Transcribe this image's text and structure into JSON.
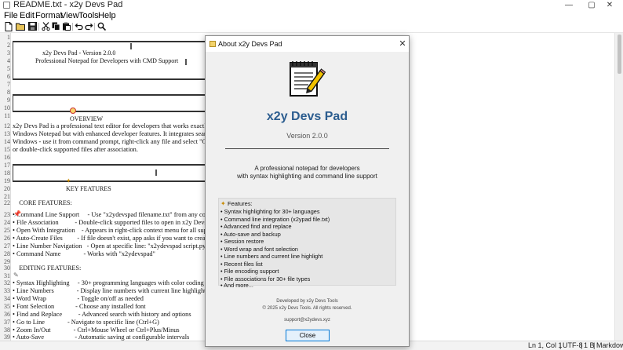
{
  "window": {
    "title": "README.txt - x2y Devs Pad",
    "minimize_glyph": "—",
    "maximize_glyph": "▢",
    "close_glyph": "✕"
  },
  "menu": [
    "File",
    "Edit",
    "Format",
    "View",
    "Tools",
    "Help"
  ],
  "toolbar": {
    "buttons": [
      "new-file-icon",
      "open-file-icon",
      "save-icon",
      "cut-icon",
      "copy-icon",
      "paste-icon",
      "undo-icon",
      "redo-icon",
      "find-icon"
    ]
  },
  "editor": {
    "header_line1": "x2y Devs Pad - Version 2.0.0",
    "header_line2": "Professional Notepad for Developers with CMD Support",
    "overview_heading": "OVERVIEW",
    "key_features_heading": "KEY FEATURES",
    "lines": [
      {
        "n": "1",
        "t": ""
      },
      {
        "n": "2",
        "t": ""
      },
      {
        "n": "3",
        "t": ""
      },
      {
        "n": "4",
        "t": ""
      },
      {
        "n": "5",
        "t": ""
      },
      {
        "n": "6",
        "t": ""
      },
      {
        "n": "7",
        "t": ""
      },
      {
        "n": "8",
        "t": ""
      },
      {
        "n": "9",
        "t": ""
      },
      {
        "n": "10",
        "t": ""
      },
      {
        "n": "11",
        "t": ""
      },
      {
        "n": "12",
        "t": "x2y Devs Pad is a professional text editor for developers that works exactly like"
      },
      {
        "n": "13",
        "t": "Windows Notepad but with enhanced developer features. It integrates seamlessly with"
      },
      {
        "n": "14",
        "t": "Windows - use it from command prompt, right-click any file and select \"Open with\","
      },
      {
        "n": "15",
        "t": "or double-click supported files after association."
      },
      {
        "n": "16",
        "t": ""
      },
      {
        "n": "17",
        "t": ""
      },
      {
        "n": "18",
        "t": ""
      },
      {
        "n": "19",
        "t": ""
      },
      {
        "n": "20",
        "t": ""
      },
      {
        "n": "21",
        "t": ""
      },
      {
        "n": "22",
        "t": "    CORE FEATURES:"
      },
      {
        "n": "23",
        "t": "• Command Line Support     - Use \"x2ydevspad filename.txt\" from any command prompt"
      },
      {
        "n": "24",
        "t": "• File Association          - Double-click supported files to open in x2y Devs Pad"
      },
      {
        "n": "25",
        "t": "• Open With Integration    - Appears in right-click context menu for all supported files"
      },
      {
        "n": "26",
        "t": "• Auto-Create Files         - If file doesn't exist, app asks if you want to create it"
      },
      {
        "n": "27",
        "t": "• Line Number Navigation   - Open at specific line: \"x2ydevspad script.py:42\""
      },
      {
        "n": "28",
        "t": "• Command Name              - Works with \"x2ydevspad\""
      },
      {
        "n": "29",
        "t": ""
      },
      {
        "n": "30",
        "t": "    EDITING FEATURES:"
      },
      {
        "n": "31",
        "t": ""
      },
      {
        "n": "32",
        "t": "• Syntax Highlighting     - 30+ programming languages with color coding"
      },
      {
        "n": "33",
        "t": "• Line Numbers              - Display line numbers with current line highlight"
      },
      {
        "n": "34",
        "t": "• Word Wrap                   - Toggle on/off as needed"
      },
      {
        "n": "35",
        "t": "• Font Selection             - Choose any installed font"
      },
      {
        "n": "36",
        "t": "• Find and Replace          - Advanced search with history and options"
      },
      {
        "n": "37",
        "t": "• Go to Line              - Navigate to specific line (Ctrl+G)"
      },
      {
        "n": "38",
        "t": "• Zoom In/Out              - Ctrl+Mouse Wheel or Ctrl+Plus/Minus"
      },
      {
        "n": "39",
        "t": "• Auto-Save                   - Automatic saving at configurable intervals"
      }
    ]
  },
  "status": {
    "position": "Ln 1, Col 1",
    "encoding": "UTF-8",
    "size": "1 B",
    "language": "Markdown"
  },
  "about": {
    "title": "About x2y Devs Pad",
    "close_glyph": "✕",
    "app_name": "x2y Devs Pad",
    "version": "Version 2.0.0",
    "description": [
      "A professional notepad for developers",
      "with syntax highlighting and command line support"
    ],
    "features_header": "Features:",
    "features": [
      "• Syntax highlighting for 30+ languages",
      "• Command line integration (x2ypad file.txt)",
      "• Advanced find and replace",
      "• Auto-save and backup",
      "• Session restore",
      "• Word wrap and font selection",
      "• Line numbers and current line highlight",
      "• Recent files list",
      "• File encoding support",
      "• File associations for 30+ file types",
      "• And more..."
    ],
    "developer": "Developed by x2y Devs Tools",
    "copyright": "© 2025 x2y Devs Tools. All rights reserved.",
    "email": "support@x2ydevs.xyz",
    "close_label": "Close"
  }
}
